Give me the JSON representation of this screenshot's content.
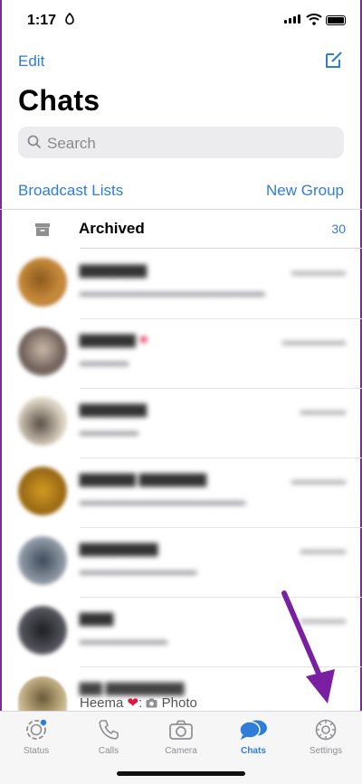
{
  "status_bar": {
    "time": "1:17"
  },
  "header": {
    "edit_label": "Edit",
    "title": "Chats"
  },
  "search": {
    "placeholder": "Search"
  },
  "links": {
    "broadcast_label": "Broadcast Lists",
    "new_group_label": "New Group"
  },
  "archived": {
    "label": "Archived",
    "count": "30"
  },
  "last_row": {
    "sender": "Heema",
    "suffix": ":",
    "preview": "Photo"
  },
  "tabs": [
    {
      "label": "Status",
      "icon": "status-icon"
    },
    {
      "label": "Calls",
      "icon": "phone-icon"
    },
    {
      "label": "Camera",
      "icon": "camera-icon"
    },
    {
      "label": "Chats",
      "icon": "chats-icon",
      "active": true
    },
    {
      "label": "Settings",
      "icon": "gear-icon"
    }
  ],
  "colors": {
    "accent": "#2f7dd6",
    "arrow": "#7a1fa2"
  }
}
